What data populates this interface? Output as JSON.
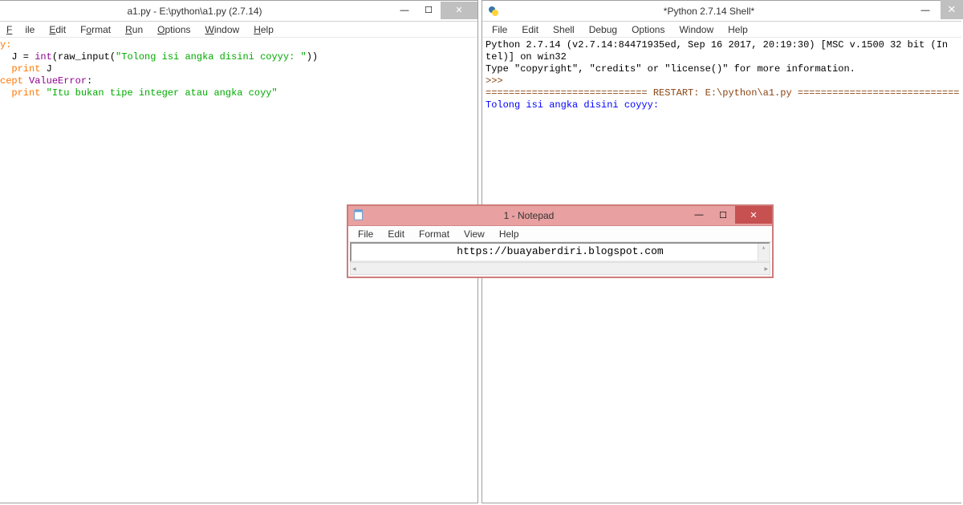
{
  "editor": {
    "title": "a1.py - E:\\python\\a1.py (2.7.14)",
    "menu": {
      "file": "File",
      "edit": "Edit",
      "format": "Format",
      "run": "Run",
      "options": "Options",
      "window": "Window",
      "help": "Help"
    },
    "code": {
      "l1a": "y",
      "l1b": ":",
      "l2a": "  J = ",
      "l2b": "int",
      "l2c": "(raw_input(",
      "l2d": "\"Tolong isi angka disini coyyy: \"",
      "l2e": "))",
      "l3a": "  ",
      "l3b": "print",
      "l3c": " J",
      "l4a": "cept",
      "l4b": " ",
      "l4c": "ValueError",
      "l4d": ":",
      "l5a": "  ",
      "l5b": "print",
      "l5c": " ",
      "l5d": "\"Itu bukan tipe integer atau angka coyy\""
    }
  },
  "shell": {
    "title": "*Python 2.7.14 Shell*",
    "menu": {
      "file": "File",
      "edit": "Edit",
      "shell": "Shell",
      "debug": "Debug",
      "options": "Options",
      "window": "Window",
      "help": "Help"
    },
    "out": {
      "l1": "Python 2.7.14 (v2.7.14:84471935ed, Sep 16 2017, 20:19:30) [MSC v.1500 32 bit (In",
      "l2": "tel)] on win32",
      "l3": "Type \"copyright\", \"credits\" or \"license()\" for more information.",
      "prompt1": ">>> ",
      "restart": "============================ RESTART: E:\\python\\a1.py ============================",
      "prompt2": "Tolong isi angka disini coyyy: "
    }
  },
  "notepad": {
    "title": "1 - Notepad",
    "menu": {
      "file": "File",
      "edit": "Edit",
      "format": "Format",
      "view": "View",
      "help": "Help"
    },
    "text": "https://buayaberdiri.blogspot.com"
  },
  "btn": {
    "min": "—",
    "max": "☐",
    "close": "✕"
  }
}
